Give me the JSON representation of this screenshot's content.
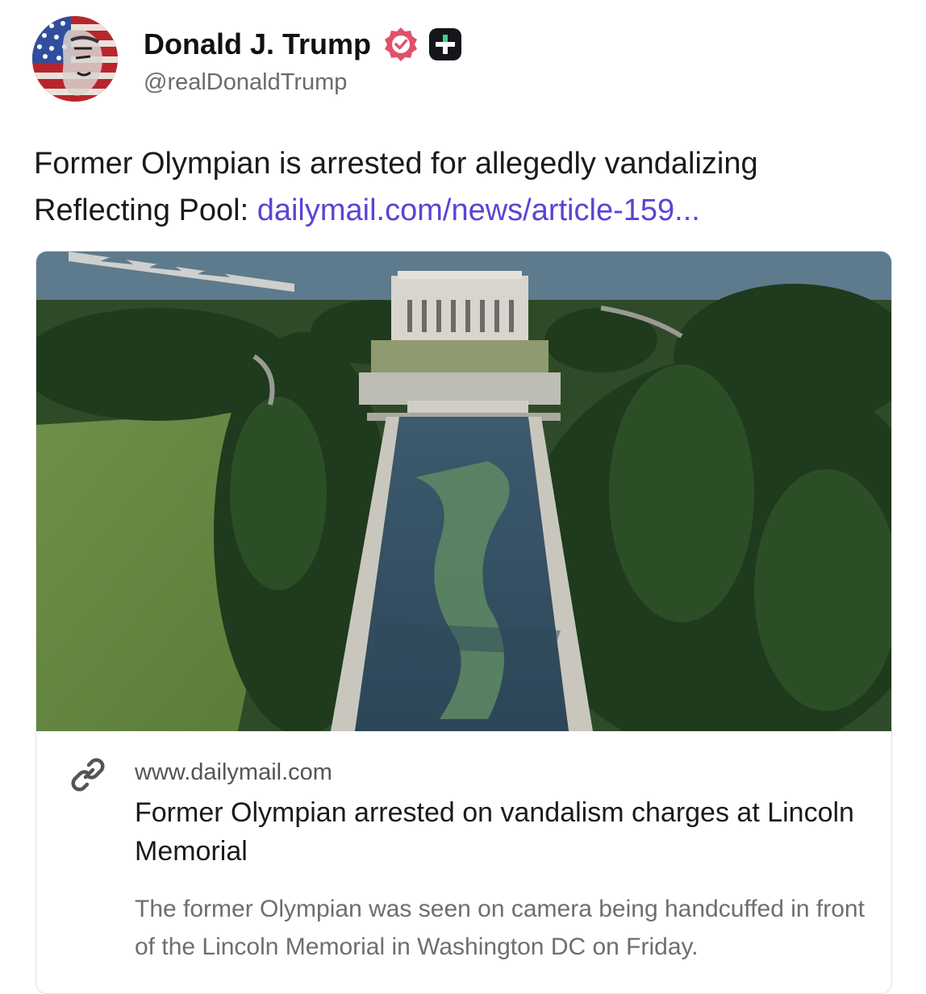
{
  "post": {
    "author": {
      "display_name": "Donald J. Trump",
      "handle": "@realDonaldTrump",
      "avatar_icon": "flag-portrait-avatar",
      "verified_icon": "verified-badge-icon",
      "plus_icon": "plus-badge-icon"
    },
    "text": "Former Olympian is arrested for allegedly vandalizing Reflecting Pool: ",
    "link_text": "dailymail.com/news/article-159..."
  },
  "card": {
    "image_subject": "Lincoln Memorial Reflecting Pool aerial view",
    "link_icon": "link-icon",
    "domain": "www.dailymail.com",
    "title": "Former Olympian arrested on vandalism charges at Lincoln Memorial",
    "description": "The former Olympian was seen on camera being handcuffed in front of the Lincoln Memorial in Washington DC on Friday."
  },
  "colors": {
    "link": "#5b43d6",
    "verified": "#e2506b",
    "text": "#1a1a1a",
    "muted": "#6e6e6e"
  }
}
